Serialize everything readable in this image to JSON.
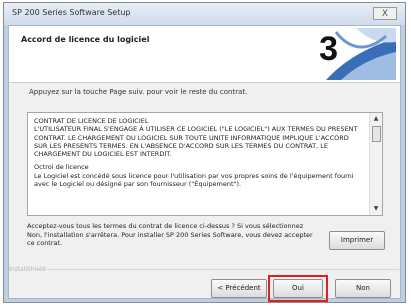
{
  "window": {
    "title": "SP 200 Series Software Setup",
    "close_label": "X"
  },
  "header": {
    "title": "Accord de licence du logiciel",
    "step_number": "3"
  },
  "instruction": "Appuyez sur la touche Page suiv. pour voir le reste du contrat.",
  "license": {
    "paragraphs": [
      "CONTRAT DE LICENCE DE LOGICIEL\nL'UTILISATEUR FINAL S'ENGAGE À UTILISER CE LOGICIEL (\"LE LOGICIEL\") AUX TERMES DU PRESENT CONTRAT. LE CHARGEMENT DU LOGICIEL SUR TOUTE UNITE INFORMATIQUE IMPLIQUE L'ACCORD SUR LES PRESENTS TERMES. EN L'ABSENCE D'ACCORD SUR LES TERMES DU CONTRAT, LE CHARGEMENT DU LOGICIEL EST INTERDIT.",
      "Octroi de licence\nLe Logiciel est concédé sous licence pour l'utilisation par vos propres soins de l'équipement fourni avec le Logiciel ou désigné par son fournisseur (\"Équipement\")."
    ]
  },
  "question": "Acceptez-vous tous les termes du contrat de licence ci-dessus ? Si vous sélectionnez Non, l'installation s'arrêtera. Pour installer SP 200 Series Software, vous devez accepter ce contrat.",
  "buttons": {
    "print": "Imprimer",
    "previous": "< Précédent",
    "yes": "Oui",
    "no": "Non"
  },
  "footer": {
    "brand": "InstallShield"
  },
  "colors": {
    "highlight": "#e02020",
    "logo_blue": "#3a6fb8"
  }
}
